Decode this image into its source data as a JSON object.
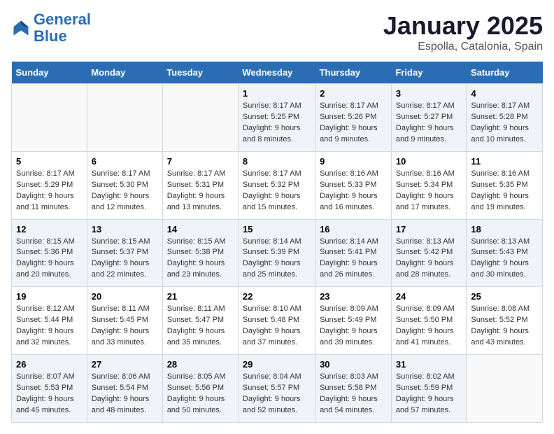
{
  "logo": {
    "line1": "General",
    "line2": "Blue"
  },
  "title": "January 2025",
  "subtitle": "Espolla, Catalonia, Spain",
  "days_of_week": [
    "Sunday",
    "Monday",
    "Tuesday",
    "Wednesday",
    "Thursday",
    "Friday",
    "Saturday"
  ],
  "weeks": [
    [
      {
        "day": "",
        "info": ""
      },
      {
        "day": "",
        "info": ""
      },
      {
        "day": "",
        "info": ""
      },
      {
        "day": "1",
        "info": "Sunrise: 8:17 AM\nSunset: 5:25 PM\nDaylight: 9 hours and 8 minutes."
      },
      {
        "day": "2",
        "info": "Sunrise: 8:17 AM\nSunset: 5:26 PM\nDaylight: 9 hours and 9 minutes."
      },
      {
        "day": "3",
        "info": "Sunrise: 8:17 AM\nSunset: 5:27 PM\nDaylight: 9 hours and 9 minutes."
      },
      {
        "day": "4",
        "info": "Sunrise: 8:17 AM\nSunset: 5:28 PM\nDaylight: 9 hours and 10 minutes."
      }
    ],
    [
      {
        "day": "5",
        "info": "Sunrise: 8:17 AM\nSunset: 5:29 PM\nDaylight: 9 hours and 11 minutes."
      },
      {
        "day": "6",
        "info": "Sunrise: 8:17 AM\nSunset: 5:30 PM\nDaylight: 9 hours and 12 minutes."
      },
      {
        "day": "7",
        "info": "Sunrise: 8:17 AM\nSunset: 5:31 PM\nDaylight: 9 hours and 13 minutes."
      },
      {
        "day": "8",
        "info": "Sunrise: 8:17 AM\nSunset: 5:32 PM\nDaylight: 9 hours and 15 minutes."
      },
      {
        "day": "9",
        "info": "Sunrise: 8:16 AM\nSunset: 5:33 PM\nDaylight: 9 hours and 16 minutes."
      },
      {
        "day": "10",
        "info": "Sunrise: 8:16 AM\nSunset: 5:34 PM\nDaylight: 9 hours and 17 minutes."
      },
      {
        "day": "11",
        "info": "Sunrise: 8:16 AM\nSunset: 5:35 PM\nDaylight: 9 hours and 19 minutes."
      }
    ],
    [
      {
        "day": "12",
        "info": "Sunrise: 8:15 AM\nSunset: 5:36 PM\nDaylight: 9 hours and 20 minutes."
      },
      {
        "day": "13",
        "info": "Sunrise: 8:15 AM\nSunset: 5:37 PM\nDaylight: 9 hours and 22 minutes."
      },
      {
        "day": "14",
        "info": "Sunrise: 8:15 AM\nSunset: 5:38 PM\nDaylight: 9 hours and 23 minutes."
      },
      {
        "day": "15",
        "info": "Sunrise: 8:14 AM\nSunset: 5:39 PM\nDaylight: 9 hours and 25 minutes."
      },
      {
        "day": "16",
        "info": "Sunrise: 8:14 AM\nSunset: 5:41 PM\nDaylight: 9 hours and 26 minutes."
      },
      {
        "day": "17",
        "info": "Sunrise: 8:13 AM\nSunset: 5:42 PM\nDaylight: 9 hours and 28 minutes."
      },
      {
        "day": "18",
        "info": "Sunrise: 8:13 AM\nSunset: 5:43 PM\nDaylight: 9 hours and 30 minutes."
      }
    ],
    [
      {
        "day": "19",
        "info": "Sunrise: 8:12 AM\nSunset: 5:44 PM\nDaylight: 9 hours and 32 minutes."
      },
      {
        "day": "20",
        "info": "Sunrise: 8:11 AM\nSunset: 5:45 PM\nDaylight: 9 hours and 33 minutes."
      },
      {
        "day": "21",
        "info": "Sunrise: 8:11 AM\nSunset: 5:47 PM\nDaylight: 9 hours and 35 minutes."
      },
      {
        "day": "22",
        "info": "Sunrise: 8:10 AM\nSunset: 5:48 PM\nDaylight: 9 hours and 37 minutes."
      },
      {
        "day": "23",
        "info": "Sunrise: 8:09 AM\nSunset: 5:49 PM\nDaylight: 9 hours and 39 minutes."
      },
      {
        "day": "24",
        "info": "Sunrise: 8:09 AM\nSunset: 5:50 PM\nDaylight: 9 hours and 41 minutes."
      },
      {
        "day": "25",
        "info": "Sunrise: 8:08 AM\nSunset: 5:52 PM\nDaylight: 9 hours and 43 minutes."
      }
    ],
    [
      {
        "day": "26",
        "info": "Sunrise: 8:07 AM\nSunset: 5:53 PM\nDaylight: 9 hours and 45 minutes."
      },
      {
        "day": "27",
        "info": "Sunrise: 8:06 AM\nSunset: 5:54 PM\nDaylight: 9 hours and 48 minutes."
      },
      {
        "day": "28",
        "info": "Sunrise: 8:05 AM\nSunset: 5:56 PM\nDaylight: 9 hours and 50 minutes."
      },
      {
        "day": "29",
        "info": "Sunrise: 8:04 AM\nSunset: 5:57 PM\nDaylight: 9 hours and 52 minutes."
      },
      {
        "day": "30",
        "info": "Sunrise: 8:03 AM\nSunset: 5:58 PM\nDaylight: 9 hours and 54 minutes."
      },
      {
        "day": "31",
        "info": "Sunrise: 8:02 AM\nSunset: 5:59 PM\nDaylight: 9 hours and 57 minutes."
      },
      {
        "day": "",
        "info": ""
      }
    ]
  ]
}
